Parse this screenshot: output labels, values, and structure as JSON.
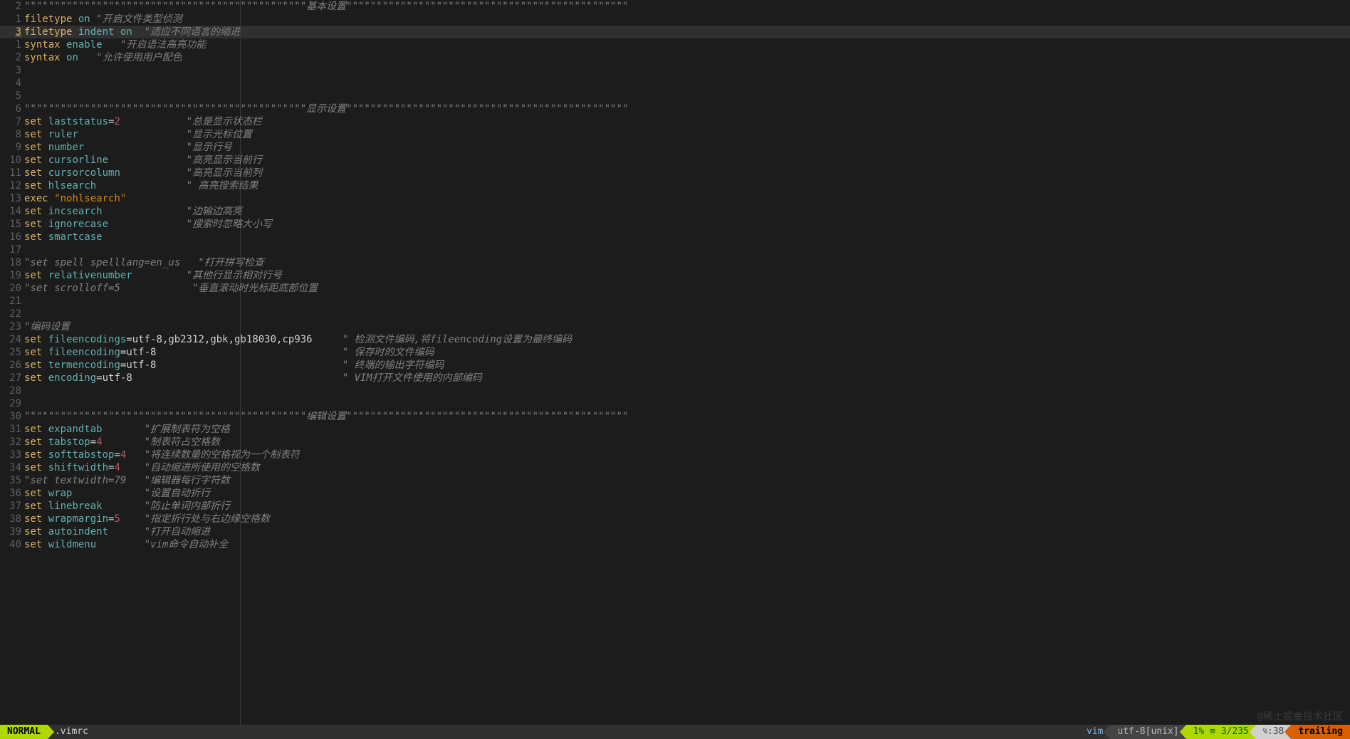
{
  "status": {
    "mode": "NORMAL",
    "filename": ".vimrc",
    "filetype": "vim",
    "encoding": "utf-8[unix]",
    "percent": "1%",
    "line_total": "3/235",
    "col": ":38",
    "trailing": "trailing"
  },
  "watermark": "@稀土掘金技术社区",
  "current_line": 2,
  "lines": [
    {
      "n": "2",
      "tokens": [
        {
          "t": "\"\"\"\"\"\"\"\"\"\"\"\"\"\"\"\"\"\"\"\"\"\"\"\"\"\"\"\"\"\"\"\"\"\"\"\"\"\"\"\"\"\"\"\"\"\"\"基本设置\"\"\"\"\"\"\"\"\"\"\"\"\"\"\"\"\"\"\"\"\"\"\"\"\"\"\"\"\"\"\"\"\"\"\"\"\"\"\"\"\"\"\"\"\"\"\"",
          "c": "cmt"
        }
      ]
    },
    {
      "n": "1",
      "tokens": [
        {
          "t": "filetype",
          "c": "kw"
        },
        {
          "t": " "
        },
        {
          "t": "on",
          "c": "opt"
        },
        {
          "t": " "
        },
        {
          "t": "\"开启文件类型侦测",
          "c": "cmt"
        }
      ]
    },
    {
      "n": "3",
      "tokens": [
        {
          "t": "filetype",
          "c": "kw"
        },
        {
          "t": " "
        },
        {
          "t": "indent",
          "c": "opt"
        },
        {
          "t": " "
        },
        {
          "t": "on",
          "c": "opt"
        },
        {
          "t": "  "
        },
        {
          "t": "\"适应不同语言的缩进",
          "c": "cmt"
        }
      ],
      "current": true
    },
    {
      "n": "1",
      "tokens": [
        {
          "t": "syntax",
          "c": "kw"
        },
        {
          "t": " "
        },
        {
          "t": "enable",
          "c": "opt"
        },
        {
          "t": "   "
        },
        {
          "t": "\"开启语法高亮功能",
          "c": "cmt"
        }
      ]
    },
    {
      "n": "2",
      "tokens": [
        {
          "t": "syntax",
          "c": "kw"
        },
        {
          "t": " "
        },
        {
          "t": "on",
          "c": "opt"
        },
        {
          "t": "   "
        },
        {
          "t": "\"允许使用用户配色",
          "c": "cmt"
        }
      ]
    },
    {
      "n": "3",
      "tokens": []
    },
    {
      "n": "4",
      "tokens": []
    },
    {
      "n": "5",
      "tokens": []
    },
    {
      "n": "6",
      "tokens": [
        {
          "t": "\"\"\"\"\"\"\"\"\"\"\"\"\"\"\"\"\"\"\"\"\"\"\"\"\"\"\"\"\"\"\"\"\"\"\"\"\"\"\"\"\"\"\"\"\"\"\"显示设置\"\"\"\"\"\"\"\"\"\"\"\"\"\"\"\"\"\"\"\"\"\"\"\"\"\"\"\"\"\"\"\"\"\"\"\"\"\"\"\"\"\"\"\"\"\"\"",
          "c": "cmt"
        }
      ]
    },
    {
      "n": "7",
      "tokens": [
        {
          "t": "set",
          "c": "kw"
        },
        {
          "t": " "
        },
        {
          "t": "laststatus",
          "c": "opt"
        },
        {
          "t": "="
        },
        {
          "t": "2",
          "c": "num"
        },
        {
          "t": "           "
        },
        {
          "t": "\"总是显示状态栏",
          "c": "cmt"
        }
      ]
    },
    {
      "n": "8",
      "tokens": [
        {
          "t": "set",
          "c": "kw"
        },
        {
          "t": " "
        },
        {
          "t": "ruler",
          "c": "opt"
        },
        {
          "t": "                  "
        },
        {
          "t": "\"显示光标位置",
          "c": "cmt"
        }
      ]
    },
    {
      "n": "9",
      "tokens": [
        {
          "t": "set",
          "c": "kw"
        },
        {
          "t": " "
        },
        {
          "t": "number",
          "c": "opt"
        },
        {
          "t": "                 "
        },
        {
          "t": "\"显示行号",
          "c": "cmt"
        }
      ]
    },
    {
      "n": "10",
      "tokens": [
        {
          "t": "set",
          "c": "kw"
        },
        {
          "t": " "
        },
        {
          "t": "cursorline",
          "c": "opt"
        },
        {
          "t": "             "
        },
        {
          "t": "\"高亮显示当前行",
          "c": "cmt"
        }
      ]
    },
    {
      "n": "11",
      "tokens": [
        {
          "t": "set",
          "c": "kw"
        },
        {
          "t": " "
        },
        {
          "t": "cursorcolumn",
          "c": "opt"
        },
        {
          "t": "           "
        },
        {
          "t": "\"高亮显示当前列",
          "c": "cmt"
        }
      ]
    },
    {
      "n": "12",
      "tokens": [
        {
          "t": "set",
          "c": "kw"
        },
        {
          "t": " "
        },
        {
          "t": "hlsearch",
          "c": "opt"
        },
        {
          "t": "               "
        },
        {
          "t": "\" 高亮搜索结果",
          "c": "cmt"
        }
      ]
    },
    {
      "n": "13",
      "tokens": [
        {
          "t": "exec",
          "c": "kw"
        },
        {
          "t": " "
        },
        {
          "t": "\"nohlsearch\"",
          "c": "str"
        }
      ]
    },
    {
      "n": "14",
      "tokens": [
        {
          "t": "set",
          "c": "kw"
        },
        {
          "t": " "
        },
        {
          "t": "incsearch",
          "c": "opt"
        },
        {
          "t": "              "
        },
        {
          "t": "\"边输边高亮",
          "c": "cmt"
        }
      ]
    },
    {
      "n": "15",
      "tokens": [
        {
          "t": "set",
          "c": "kw"
        },
        {
          "t": " "
        },
        {
          "t": "ignorecase",
          "c": "opt"
        },
        {
          "t": "             "
        },
        {
          "t": "\"搜索时忽略大小写",
          "c": "cmt"
        }
      ]
    },
    {
      "n": "16",
      "tokens": [
        {
          "t": "set",
          "c": "kw"
        },
        {
          "t": " "
        },
        {
          "t": "smartcase",
          "c": "opt"
        }
      ]
    },
    {
      "n": "17",
      "tokens": []
    },
    {
      "n": "18",
      "tokens": [
        {
          "t": "\"set spell spelllang=en_us   \"打开拼写检查",
          "c": "cmt"
        }
      ]
    },
    {
      "n": "19",
      "tokens": [
        {
          "t": "set",
          "c": "kw"
        },
        {
          "t": " "
        },
        {
          "t": "relativenumber",
          "c": "opt"
        },
        {
          "t": "         "
        },
        {
          "t": "\"其他行显示相对行号",
          "c": "cmt"
        }
      ]
    },
    {
      "n": "20",
      "tokens": [
        {
          "t": "\"set scrolloff=5            \"垂直滚动时光标距底部位置",
          "c": "cmt"
        }
      ]
    },
    {
      "n": "21",
      "tokens": []
    },
    {
      "n": "22",
      "tokens": []
    },
    {
      "n": "23",
      "tokens": [
        {
          "t": "\"编码设置",
          "c": "cmt"
        }
      ]
    },
    {
      "n": "24",
      "tokens": [
        {
          "t": "set",
          "c": "kw"
        },
        {
          "t": " "
        },
        {
          "t": "fileencodings",
          "c": "opt"
        },
        {
          "t": "=utf-8,gb2312,gbk,gb18030,cp936     "
        },
        {
          "t": "\" 检测文件编码,将fileencoding设置为最终编码",
          "c": "cmt"
        }
      ]
    },
    {
      "n": "25",
      "tokens": [
        {
          "t": "set",
          "c": "kw"
        },
        {
          "t": " "
        },
        {
          "t": "fileencoding",
          "c": "opt"
        },
        {
          "t": "=utf-8                               "
        },
        {
          "t": "\" 保存时的文件编码",
          "c": "cmt"
        }
      ]
    },
    {
      "n": "26",
      "tokens": [
        {
          "t": "set",
          "c": "kw"
        },
        {
          "t": " "
        },
        {
          "t": "termencoding",
          "c": "opt"
        },
        {
          "t": "=utf-8                               "
        },
        {
          "t": "\" 终端的输出字符编码",
          "c": "cmt"
        }
      ]
    },
    {
      "n": "27",
      "tokens": [
        {
          "t": "set",
          "c": "kw"
        },
        {
          "t": " "
        },
        {
          "t": "encoding",
          "c": "opt"
        },
        {
          "t": "=utf-8                                   "
        },
        {
          "t": "\" VIM打开文件使用的内部编码",
          "c": "cmt"
        }
      ]
    },
    {
      "n": "28",
      "tokens": []
    },
    {
      "n": "29",
      "tokens": []
    },
    {
      "n": "30",
      "tokens": [
        {
          "t": "\"\"\"\"\"\"\"\"\"\"\"\"\"\"\"\"\"\"\"\"\"\"\"\"\"\"\"\"\"\"\"\"\"\"\"\"\"\"\"\"\"\"\"\"\"\"\"编辑设置\"\"\"\"\"\"\"\"\"\"\"\"\"\"\"\"\"\"\"\"\"\"\"\"\"\"\"\"\"\"\"\"\"\"\"\"\"\"\"\"\"\"\"\"\"\"\"",
          "c": "cmt"
        }
      ]
    },
    {
      "n": "31",
      "tokens": [
        {
          "t": "set",
          "c": "kw"
        },
        {
          "t": " "
        },
        {
          "t": "expandtab",
          "c": "opt"
        },
        {
          "t": "       "
        },
        {
          "t": "\"扩展制表符为空格",
          "c": "cmt"
        }
      ]
    },
    {
      "n": "32",
      "tokens": [
        {
          "t": "set",
          "c": "kw"
        },
        {
          "t": " "
        },
        {
          "t": "tabstop",
          "c": "opt"
        },
        {
          "t": "="
        },
        {
          "t": "4",
          "c": "num"
        },
        {
          "t": "       "
        },
        {
          "t": "\"制表符占空格数",
          "c": "cmt"
        }
      ]
    },
    {
      "n": "33",
      "tokens": [
        {
          "t": "set",
          "c": "kw"
        },
        {
          "t": " "
        },
        {
          "t": "softtabstop",
          "c": "opt"
        },
        {
          "t": "="
        },
        {
          "t": "4",
          "c": "num"
        },
        {
          "t": "   "
        },
        {
          "t": "\"将连续数量的空格视为一个制表符",
          "c": "cmt"
        }
      ]
    },
    {
      "n": "34",
      "tokens": [
        {
          "t": "set",
          "c": "kw"
        },
        {
          "t": " "
        },
        {
          "t": "shiftwidth",
          "c": "opt"
        },
        {
          "t": "="
        },
        {
          "t": "4",
          "c": "num"
        },
        {
          "t": "    "
        },
        {
          "t": "\"自动缩进所使用的空格数",
          "c": "cmt"
        }
      ]
    },
    {
      "n": "35",
      "tokens": [
        {
          "t": "\"set textwidth=79   \"编辑器每行字符数",
          "c": "cmt"
        }
      ]
    },
    {
      "n": "36",
      "tokens": [
        {
          "t": "set",
          "c": "kw"
        },
        {
          "t": " "
        },
        {
          "t": "wrap",
          "c": "opt"
        },
        {
          "t": "            "
        },
        {
          "t": "\"设置自动折行",
          "c": "cmt"
        }
      ]
    },
    {
      "n": "37",
      "tokens": [
        {
          "t": "set",
          "c": "kw"
        },
        {
          "t": " "
        },
        {
          "t": "linebreak",
          "c": "opt"
        },
        {
          "t": "       "
        },
        {
          "t": "\"防止单词内部折行",
          "c": "cmt"
        }
      ]
    },
    {
      "n": "38",
      "tokens": [
        {
          "t": "set",
          "c": "kw"
        },
        {
          "t": " "
        },
        {
          "t": "wrapmargin",
          "c": "opt"
        },
        {
          "t": "="
        },
        {
          "t": "5",
          "c": "num"
        },
        {
          "t": "    "
        },
        {
          "t": "\"指定折行处与右边缘空格数",
          "c": "cmt"
        }
      ]
    },
    {
      "n": "39",
      "tokens": [
        {
          "t": "set",
          "c": "kw"
        },
        {
          "t": " "
        },
        {
          "t": "autoindent",
          "c": "opt"
        },
        {
          "t": "      "
        },
        {
          "t": "\"打开自动缩进",
          "c": "cmt"
        }
      ]
    },
    {
      "n": "40",
      "tokens": [
        {
          "t": "set",
          "c": "kw"
        },
        {
          "t": " "
        },
        {
          "t": "wildmenu",
          "c": "opt"
        },
        {
          "t": "        "
        },
        {
          "t": "\"vim命令自动补全",
          "c": "cmt"
        }
      ]
    }
  ]
}
